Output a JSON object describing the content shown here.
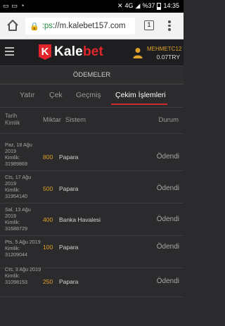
{
  "statusbar": {
    "network": "4G",
    "battery": "%37",
    "time": "14:35"
  },
  "browser": {
    "url_scheme": ":ps",
    "url_rest": "://m.kalebet157.com",
    "tab_count": "1"
  },
  "site": {
    "logo_letter": "K",
    "logo_part1": "Kale",
    "logo_part2": "bet",
    "username": "MEHMETC12...",
    "balance": "0.07TRY"
  },
  "page": {
    "title": "ÖDEMELER"
  },
  "tabs": [
    {
      "label": "Yatır"
    },
    {
      "label": "Çek"
    },
    {
      "label": "Geçmiş"
    },
    {
      "label": "Çekim İşlemleri"
    }
  ],
  "table": {
    "headers": {
      "date": "Tarih",
      "id": "Kimlik",
      "amount": "Miktar",
      "system": "Sistem",
      "status": "Durum"
    },
    "rows": [
      {
        "date": "Paz, 18 Ağu 2019",
        "id_label": "Kimlik:",
        "id": "31989869",
        "amount": "800",
        "system": "Papara",
        "status": "Ödendi"
      },
      {
        "date": "Cts, 17 Ağu 2019",
        "id_label": "Kimlik:",
        "id": "31954140",
        "amount": "500",
        "system": "Papara",
        "status": "Ödendi"
      },
      {
        "date": "Sal, 13 Ağu 2019",
        "id_label": "Kimlik:",
        "id": "31688729",
        "amount": "400",
        "system": "Banka Havalesi",
        "status": "Ödendi"
      },
      {
        "date": "Pts, 5 Ağu 2019",
        "id_label": "Kimlik:",
        "id": "31209044",
        "amount": "100",
        "system": "Papara",
        "status": "Ödendi"
      },
      {
        "date": "Cts, 3 Ağu 2019",
        "id_label": "Kimlik:",
        "id": "31098153",
        "amount": "250",
        "system": "Papara",
        "status": "Ödendi"
      }
    ]
  }
}
